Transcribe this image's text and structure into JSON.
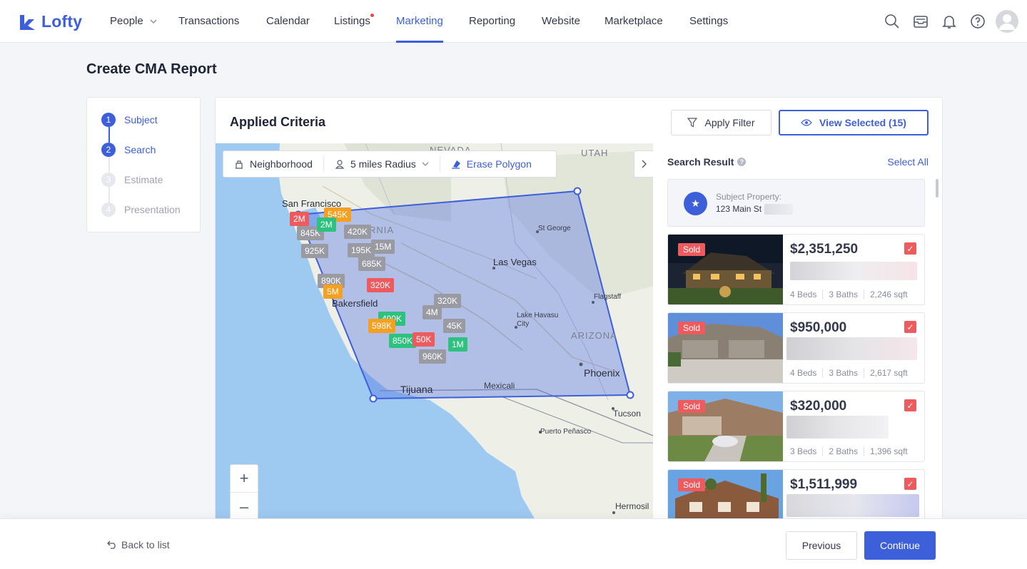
{
  "app": {
    "name": "Lofty",
    "accent": "#3d5fd9"
  },
  "nav": {
    "items": [
      {
        "label": "People"
      },
      {
        "label": "Transactions"
      },
      {
        "label": "Calendar"
      },
      {
        "label": "Listings"
      },
      {
        "label": "Marketing"
      },
      {
        "label": "Reporting"
      },
      {
        "label": "Website"
      },
      {
        "label": "Marketplace"
      },
      {
        "label": "Settings"
      }
    ],
    "active": "Marketing",
    "icons": [
      "search-icon",
      "inbox-icon",
      "bell-icon",
      "help-icon",
      "avatar"
    ]
  },
  "page": {
    "title": "Create CMA Report"
  },
  "steps": [
    {
      "num": "1",
      "label": "Subject",
      "state": "done"
    },
    {
      "num": "2",
      "label": "Search",
      "state": "current"
    },
    {
      "num": "3",
      "label": "Estimate",
      "state": "pending"
    },
    {
      "num": "4",
      "label": "Presentation",
      "state": "pending"
    }
  ],
  "criteria": {
    "title": "Applied Criteria",
    "apply_filter": "Apply Filter",
    "view_selected": "View Selected (15)"
  },
  "map": {
    "toolbar": {
      "neighborhood": "Neighborhood",
      "radius": "5 miles Radius",
      "erase": "Erase Polygon"
    },
    "labels": {
      "nevada": "NEVADA",
      "utah": "UTAH",
      "arizona": "ARIZONA",
      "rnia": "RNIA",
      "san_francisco": "San Francisco",
      "st_george": "St George",
      "las_vegas": "Las Vegas",
      "flagstaff": "Flagstaff",
      "bakersfield": "Bakersfield",
      "lake_havasu": "Lake Havasu",
      "city": "City",
      "phoenix": "Phoenix",
      "tijuana": "Tijuana",
      "mexicali": "Mexicali",
      "tucson": "Tucson",
      "puerto_penasco": "Puerto Peñasco",
      "hermosillo": "Hermosil"
    },
    "pins": [
      {
        "label": "2M",
        "color": "red"
      },
      {
        "label": "545K",
        "color": "orange"
      },
      {
        "label": "845K",
        "color": "gray"
      },
      {
        "label": "2M",
        "color": "green"
      },
      {
        "label": "420K",
        "color": "gray"
      },
      {
        "label": "925K",
        "color": "gray"
      },
      {
        "label": "15M",
        "color": "gray"
      },
      {
        "label": "195K",
        "color": "gray"
      },
      {
        "label": "685K",
        "color": "gray"
      },
      {
        "label": "890K",
        "color": "gray"
      },
      {
        "label": "5M",
        "color": "orange"
      },
      {
        "label": "320K",
        "color": "red"
      },
      {
        "label": "320K",
        "color": "gray"
      },
      {
        "label": "4M",
        "color": "gray"
      },
      {
        "label": "490K",
        "color": "green"
      },
      {
        "label": "598K",
        "color": "orange"
      },
      {
        "label": "45K",
        "color": "gray"
      },
      {
        "label": "850K",
        "color": "green"
      },
      {
        "label": "50K",
        "color": "red"
      },
      {
        "label": "1M",
        "color": "green"
      },
      {
        "label": "960K",
        "color": "gray"
      }
    ],
    "zoom_in": "+",
    "zoom_out": "–"
  },
  "results": {
    "title": "Search Result",
    "select_all": "Select All",
    "subject": {
      "label": "Subject Property:",
      "address": "123 Main St"
    },
    "listings": [
      {
        "badge": "Sold",
        "price": "$2,351,250",
        "beds": "4 Beds",
        "baths": "3 Baths",
        "sqft": "2,246 sqft",
        "photo": "night"
      },
      {
        "badge": "Sold",
        "price": "$950,000",
        "beds": "4 Beds",
        "baths": "3 Baths",
        "sqft": "2,617 sqft",
        "photo": "garage"
      },
      {
        "badge": "Sold",
        "price": "$320,000",
        "beds": "3 Beds",
        "baths": "2 Baths",
        "sqft": "1,396 sqft",
        "photo": "ranch"
      },
      {
        "badge": "Sold",
        "price": "$1,511,999",
        "beds": "",
        "baths": "",
        "sqft": "",
        "photo": "twostory"
      }
    ]
  },
  "footer": {
    "back": "Back to list",
    "previous": "Previous",
    "continue": "Continue"
  }
}
